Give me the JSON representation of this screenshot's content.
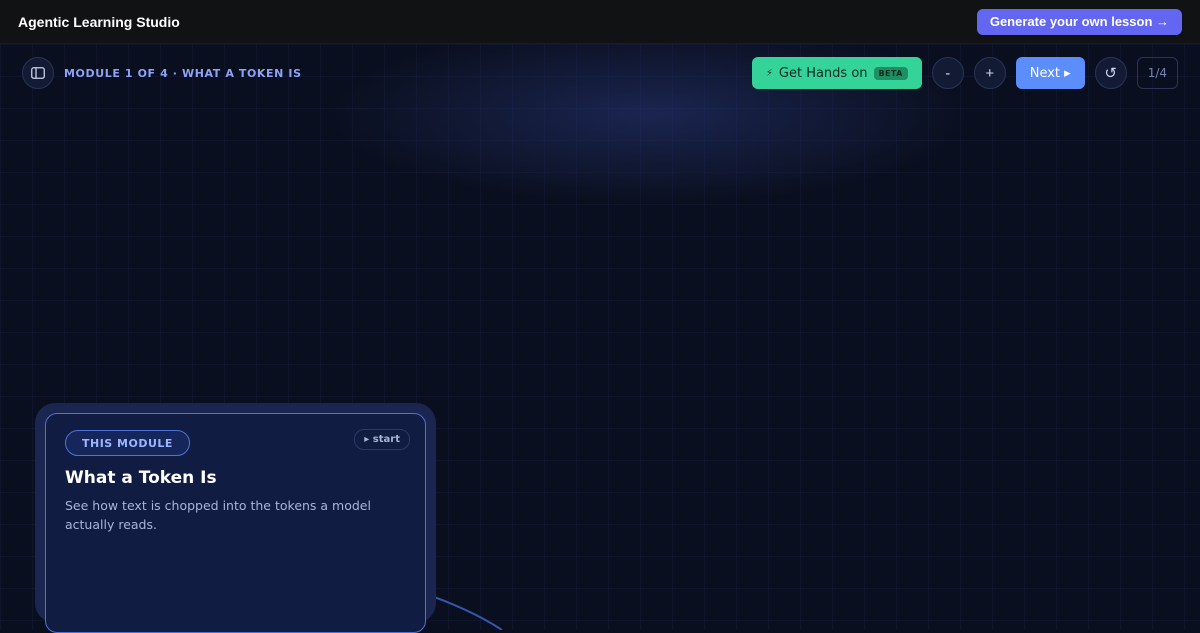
{
  "header": {
    "app_title": "Agentic Learning Studio",
    "generate_label": "Generate your own lesson →"
  },
  "toolbar": {
    "sidebar_icon": "sidebar-toggle-icon",
    "breadcrumb": "MODULE 1 OF 4 · WHAT A TOKEN IS",
    "hands_on_icon": "⚡",
    "hands_on_label": "Get Hands on",
    "beta_label": "BETA",
    "zoom_out_label": "-",
    "zoom_in_label": "+",
    "next_label": "Next ▸",
    "reset_icon": "↺",
    "page_indicator": "1/4"
  },
  "card": {
    "badge": "THIS MODULE",
    "start_label": "▸ start",
    "title": "What a Token Is",
    "description": "See how text is chopped into the tokens a model actually reads."
  },
  "colors": {
    "accent": "#6366f1",
    "hands_on": "#34d399",
    "next": "#5b8dfb",
    "card_border": "#4f72d8",
    "background": "#0a0f1f"
  }
}
